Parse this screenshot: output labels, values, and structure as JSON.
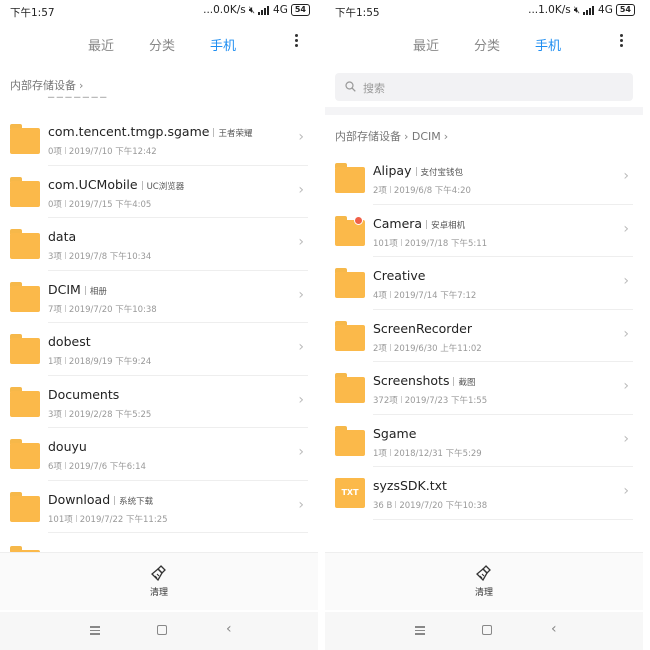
{
  "left": {
    "status": {
      "time": "下午1:57",
      "speed": "...0.0K/s",
      "network": "4G",
      "battery": "54"
    },
    "tabs": [
      "最近",
      "分类",
      "手机"
    ],
    "active_tab": "手机",
    "breadcrumb": [
      "内部存储设备"
    ],
    "items": [
      {
        "name": "com.tencent.tmgp.sgame",
        "alias": "王者荣耀",
        "count": "0项",
        "date": "2019/7/10 下午12:42"
      },
      {
        "name": "com.UCMobile",
        "alias": "UC浏览器",
        "count": "0项",
        "date": "2019/7/15 下午4:05"
      },
      {
        "name": "data",
        "alias": "",
        "count": "3项",
        "date": "2019/7/8 下午10:34"
      },
      {
        "name": "DCIM",
        "alias": "相册",
        "count": "7项",
        "date": "2019/7/20 下午10:38"
      },
      {
        "name": "dobest",
        "alias": "",
        "count": "1项",
        "date": "2018/9/19 下午9:24"
      },
      {
        "name": "Documents",
        "alias": "",
        "count": "3项",
        "date": "2019/2/28 下午5:25"
      },
      {
        "name": "douyu",
        "alias": "",
        "count": "6项",
        "date": "2019/7/6 下午6:14"
      },
      {
        "name": "Download",
        "alias": "系统下载",
        "count": "101项",
        "date": "2019/7/22 下午11:25"
      }
    ],
    "clean_label": "清理"
  },
  "right": {
    "status": {
      "time": "下午1:55",
      "speed": "...1.0K/s",
      "network": "4G",
      "battery": "54"
    },
    "tabs": [
      "最近",
      "分类",
      "手机"
    ],
    "active_tab": "手机",
    "search_placeholder": "搜索",
    "breadcrumb": [
      "内部存储设备",
      "DCIM"
    ],
    "items": [
      {
        "name": "Alipay",
        "alias": "支付宝钱包",
        "count": "2项",
        "date": "2019/6/8 下午4:20",
        "kind": "folder"
      },
      {
        "name": "Camera",
        "alias": "安卓相机",
        "count": "101项",
        "date": "2019/7/18 下午5:11",
        "kind": "folder-badge"
      },
      {
        "name": "Creative",
        "alias": "",
        "count": "4项",
        "date": "2019/7/14 下午7:12",
        "kind": "folder"
      },
      {
        "name": "ScreenRecorder",
        "alias": "",
        "count": "2项",
        "date": "2019/6/30 上午11:02",
        "kind": "folder"
      },
      {
        "name": "Screenshots",
        "alias": "截图",
        "count": "372项",
        "date": "2019/7/23 下午1:55",
        "kind": "folder"
      },
      {
        "name": "Sgame",
        "alias": "",
        "count": "1项",
        "date": "2018/12/31 下午5:29",
        "kind": "folder"
      },
      {
        "name": "syzsSDK.txt",
        "alias": "",
        "count": "36 B",
        "date": "2019/7/20 下午10:38",
        "kind": "txt",
        "badge": "TXT"
      }
    ],
    "clean_label": "清理"
  },
  "colors": {
    "accent": "#1f8ef1",
    "folder": "#fbb94a",
    "badge": "#f06048"
  },
  "icons": {
    "folder": "folder-icon",
    "txt": "txt-file-icon",
    "chevron": "chevron-right-icon",
    "clean": "broom-icon",
    "more": "more-vertical-icon",
    "search": "search-icon"
  }
}
